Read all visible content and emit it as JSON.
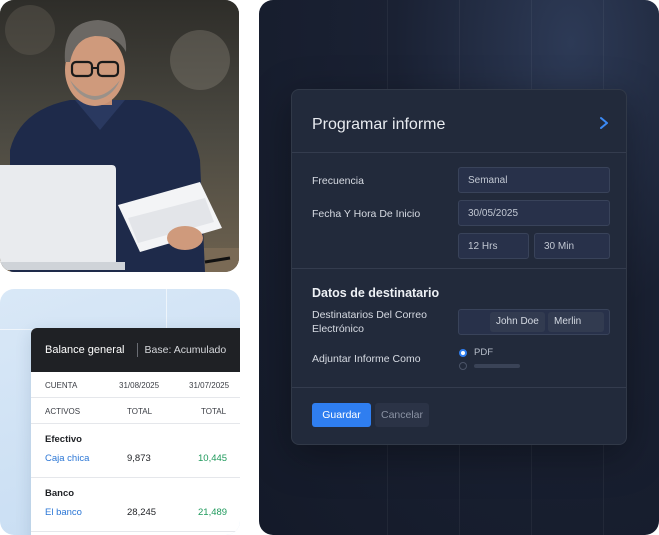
{
  "balance": {
    "title": "Balance general",
    "base": "Base: Acumulado",
    "columns": {
      "label": "CUENTA",
      "date1": "31/08/2025",
      "date2": "31/07/2025"
    },
    "sub": {
      "label": "ACTIVOS",
      "total1": "TOTAL",
      "total2": "TOTAL"
    },
    "sections": [
      {
        "title": "Efectivo",
        "account": "Caja chica",
        "v1": "9,873",
        "v2": "10,445"
      },
      {
        "title": "Banco",
        "account": "El banco",
        "v1": "28,245",
        "v2": "21,489"
      }
    ]
  },
  "dialog": {
    "title": "Programar informe",
    "frequency": {
      "label": "Frecuencia",
      "value": "Semanal"
    },
    "start": {
      "label": "Fecha Y Hora De Inicio",
      "date": "30/05/2025",
      "hours": "12 Hrs",
      "minutes": "30 Min"
    },
    "recipients": {
      "section_title": "Datos de destinatario",
      "emails_label": "Destinatarios Del Correo Electrónico",
      "chips": [
        "John Doe",
        "Merlin"
      ]
    },
    "attach": {
      "label": "Adjuntar Informe Como",
      "option_pdf": "PDF"
    },
    "save_label": "Guardar",
    "cancel_label": "Cancelar"
  },
  "colors": {
    "primary": "#2f7ef0",
    "positive": "#1f9a5c",
    "link": "#2c77d6",
    "panel_bg": "#141a29",
    "dialog_bg": "#222a3b"
  }
}
